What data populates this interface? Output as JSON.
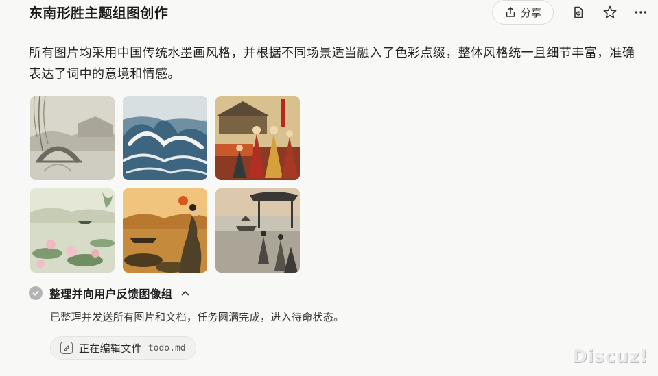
{
  "header": {
    "title": "东南形胜主题组图创作",
    "share_label": "分享",
    "icons": [
      "share-icon",
      "document-icon",
      "star-icon",
      "more-icon"
    ]
  },
  "message": {
    "description": "所有图片均采用中国传统水墨画风格，并根据不同场景适当融入了色彩点缀，整体风格统一且细节丰富，准确表达了词中的意境和情感。"
  },
  "gallery": {
    "images": [
      {
        "subject": "stone-arch-bridge-willow"
      },
      {
        "subject": "river-tidal-waves"
      },
      {
        "subject": "market-crowd"
      },
      {
        "subject": "lotus-lake"
      },
      {
        "subject": "sunset-lotus-girl"
      },
      {
        "subject": "pavilion-boat-gathering"
      }
    ]
  },
  "step": {
    "label": "整理并向用户反馈图像组",
    "detail": "已整理并发送所有图片和文档，任务圆满完成，进入待命状态。",
    "status_icon": "check-icon",
    "toggle_icon": "chevron-up-icon"
  },
  "file_action": {
    "action": "正在编辑文件",
    "filename": "todo.md",
    "icon": "edit-icon"
  },
  "watermark": {
    "text": "Discuz!"
  },
  "colors": {
    "background": "#f8f8f7",
    "check_bg": "#b3b3b3",
    "pill_bg": "#f1f1ef"
  }
}
